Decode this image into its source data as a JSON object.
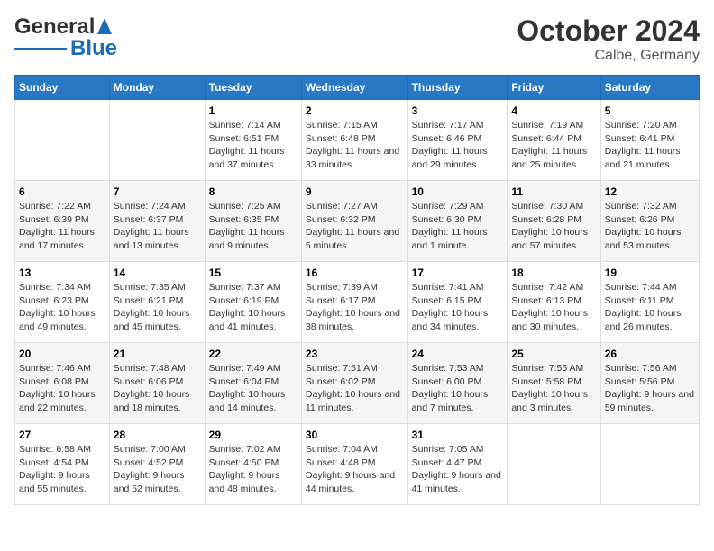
{
  "logo": {
    "line1": "General",
    "line2": "Blue"
  },
  "title": "October 2024",
  "location": "Calbe, Germany",
  "days_of_week": [
    "Sunday",
    "Monday",
    "Tuesday",
    "Wednesday",
    "Thursday",
    "Friday",
    "Saturday"
  ],
  "weeks": [
    [
      {
        "day": "",
        "info": ""
      },
      {
        "day": "",
        "info": ""
      },
      {
        "day": "1",
        "info": "Sunrise: 7:14 AM\nSunset: 6:51 PM\nDaylight: 11 hours and 37 minutes."
      },
      {
        "day": "2",
        "info": "Sunrise: 7:15 AM\nSunset: 6:48 PM\nDaylight: 11 hours and 33 minutes."
      },
      {
        "day": "3",
        "info": "Sunrise: 7:17 AM\nSunset: 6:46 PM\nDaylight: 11 hours and 29 minutes."
      },
      {
        "day": "4",
        "info": "Sunrise: 7:19 AM\nSunset: 6:44 PM\nDaylight: 11 hours and 25 minutes."
      },
      {
        "day": "5",
        "info": "Sunrise: 7:20 AM\nSunset: 6:41 PM\nDaylight: 11 hours and 21 minutes."
      }
    ],
    [
      {
        "day": "6",
        "info": "Sunrise: 7:22 AM\nSunset: 6:39 PM\nDaylight: 11 hours and 17 minutes."
      },
      {
        "day": "7",
        "info": "Sunrise: 7:24 AM\nSunset: 6:37 PM\nDaylight: 11 hours and 13 minutes."
      },
      {
        "day": "8",
        "info": "Sunrise: 7:25 AM\nSunset: 6:35 PM\nDaylight: 11 hours and 9 minutes."
      },
      {
        "day": "9",
        "info": "Sunrise: 7:27 AM\nSunset: 6:32 PM\nDaylight: 11 hours and 5 minutes."
      },
      {
        "day": "10",
        "info": "Sunrise: 7:29 AM\nSunset: 6:30 PM\nDaylight: 11 hours and 1 minute."
      },
      {
        "day": "11",
        "info": "Sunrise: 7:30 AM\nSunset: 6:28 PM\nDaylight: 10 hours and 57 minutes."
      },
      {
        "day": "12",
        "info": "Sunrise: 7:32 AM\nSunset: 6:26 PM\nDaylight: 10 hours and 53 minutes."
      }
    ],
    [
      {
        "day": "13",
        "info": "Sunrise: 7:34 AM\nSunset: 6:23 PM\nDaylight: 10 hours and 49 minutes."
      },
      {
        "day": "14",
        "info": "Sunrise: 7:35 AM\nSunset: 6:21 PM\nDaylight: 10 hours and 45 minutes."
      },
      {
        "day": "15",
        "info": "Sunrise: 7:37 AM\nSunset: 6:19 PM\nDaylight: 10 hours and 41 minutes."
      },
      {
        "day": "16",
        "info": "Sunrise: 7:39 AM\nSunset: 6:17 PM\nDaylight: 10 hours and 38 minutes."
      },
      {
        "day": "17",
        "info": "Sunrise: 7:41 AM\nSunset: 6:15 PM\nDaylight: 10 hours and 34 minutes."
      },
      {
        "day": "18",
        "info": "Sunrise: 7:42 AM\nSunset: 6:13 PM\nDaylight: 10 hours and 30 minutes."
      },
      {
        "day": "19",
        "info": "Sunrise: 7:44 AM\nSunset: 6:11 PM\nDaylight: 10 hours and 26 minutes."
      }
    ],
    [
      {
        "day": "20",
        "info": "Sunrise: 7:46 AM\nSunset: 6:08 PM\nDaylight: 10 hours and 22 minutes."
      },
      {
        "day": "21",
        "info": "Sunrise: 7:48 AM\nSunset: 6:06 PM\nDaylight: 10 hours and 18 minutes."
      },
      {
        "day": "22",
        "info": "Sunrise: 7:49 AM\nSunset: 6:04 PM\nDaylight: 10 hours and 14 minutes."
      },
      {
        "day": "23",
        "info": "Sunrise: 7:51 AM\nSunset: 6:02 PM\nDaylight: 10 hours and 11 minutes."
      },
      {
        "day": "24",
        "info": "Sunrise: 7:53 AM\nSunset: 6:00 PM\nDaylight: 10 hours and 7 minutes."
      },
      {
        "day": "25",
        "info": "Sunrise: 7:55 AM\nSunset: 5:58 PM\nDaylight: 10 hours and 3 minutes."
      },
      {
        "day": "26",
        "info": "Sunrise: 7:56 AM\nSunset: 5:56 PM\nDaylight: 9 hours and 59 minutes."
      }
    ],
    [
      {
        "day": "27",
        "info": "Sunrise: 6:58 AM\nSunset: 4:54 PM\nDaylight: 9 hours and 55 minutes."
      },
      {
        "day": "28",
        "info": "Sunrise: 7:00 AM\nSunset: 4:52 PM\nDaylight: 9 hours and 52 minutes."
      },
      {
        "day": "29",
        "info": "Sunrise: 7:02 AM\nSunset: 4:50 PM\nDaylight: 9 hours and 48 minutes."
      },
      {
        "day": "30",
        "info": "Sunrise: 7:04 AM\nSunset: 4:48 PM\nDaylight: 9 hours and 44 minutes."
      },
      {
        "day": "31",
        "info": "Sunrise: 7:05 AM\nSunset: 4:47 PM\nDaylight: 9 hours and 41 minutes."
      },
      {
        "day": "",
        "info": ""
      },
      {
        "day": "",
        "info": ""
      }
    ]
  ]
}
